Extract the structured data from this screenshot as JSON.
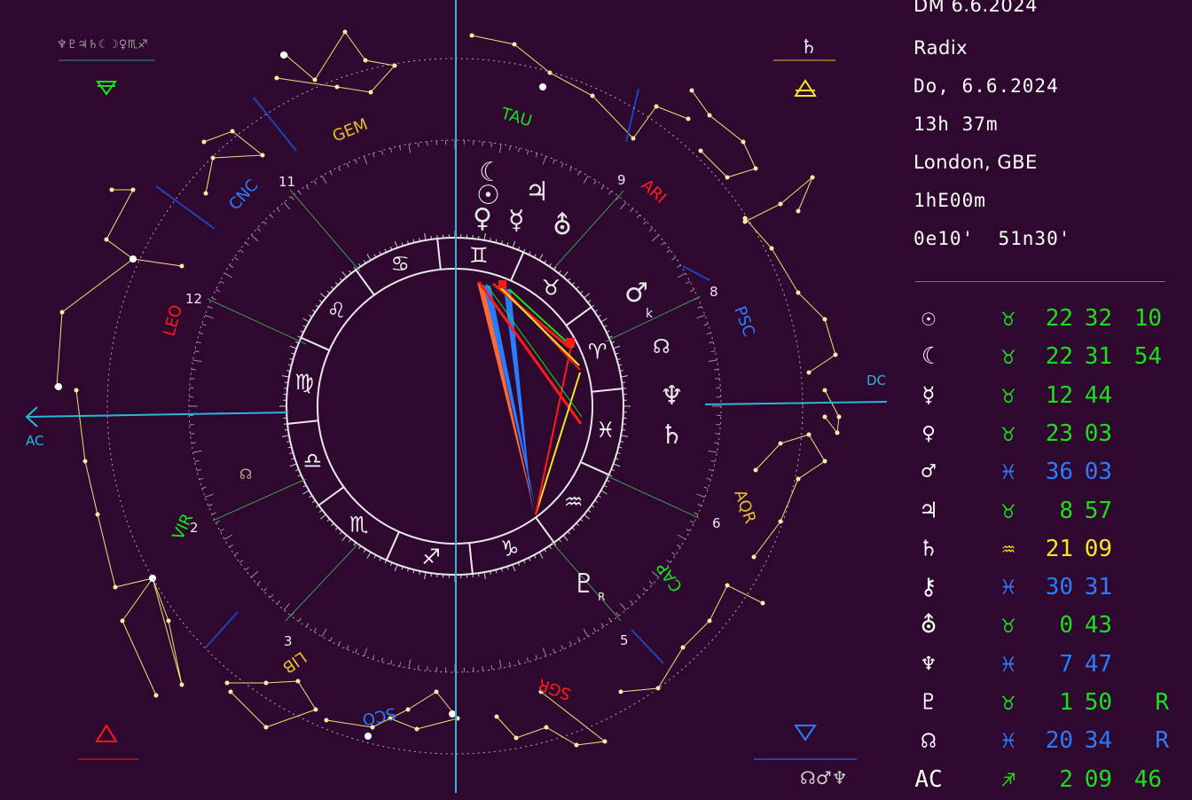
{
  "header": {
    "title": "DM 6.6.2024",
    "chart_type": "Radix",
    "date": "Do, 6.6.2024",
    "time": "13h 37m",
    "place": "London, GBE",
    "zone": "1hE00m",
    "coords": "0e10'  51n30'"
  },
  "colors": {
    "background": "#2f0830",
    "earth": "#19e119",
    "water": "#2a7cff",
    "air": "#f2e623",
    "fire": "#ff1a1a",
    "ring": "#e8e8e8",
    "constellation": "#eee37a",
    "axis": "#2ab7d8"
  },
  "chart": {
    "axis_labels": {
      "ac": "AC",
      "dc": "DC"
    },
    "top_left_glyphs": "♆♇♃♄☾☽♀♏♐",
    "bottom_right_glyphs": "☊♂♆",
    "constellations": [
      "GEM",
      "TAU",
      "ARI",
      "CNC",
      "PSC",
      "LEO",
      "AQR",
      "VIR",
      "CAP",
      "LIB",
      "SCO",
      "SGR"
    ],
    "house_numbers": [
      "11",
      "9",
      "8",
      "12",
      "2",
      "3",
      "5",
      "6"
    ]
  },
  "positions": [
    {
      "planet": "sun-icon",
      "planet_glyph": "☉",
      "sign": "taurus-icon",
      "sign_glyph": "♉",
      "deg": "22",
      "min": "32",
      "sec": "10",
      "retro": "",
      "color": "#19e119"
    },
    {
      "planet": "moon-icon",
      "planet_glyph": "☾",
      "sign": "taurus-icon",
      "sign_glyph": "♉",
      "deg": "22",
      "min": "31",
      "sec": "54",
      "retro": "",
      "color": "#19e119"
    },
    {
      "planet": "mercury-icon",
      "planet_glyph": "☿",
      "sign": "taurus-icon",
      "sign_glyph": "♉",
      "deg": "12",
      "min": "44",
      "sec": "",
      "retro": "",
      "color": "#19e119"
    },
    {
      "planet": "venus-icon",
      "planet_glyph": "♀",
      "sign": "taurus-icon",
      "sign_glyph": "♉",
      "deg": "23",
      "min": "03",
      "sec": "",
      "retro": "",
      "color": "#19e119"
    },
    {
      "planet": "mars-icon",
      "planet_glyph": "♂",
      "sign": "pisces-icon",
      "sign_glyph": "♓",
      "deg": "36",
      "min": "03",
      "sec": "",
      "retro": "",
      "color": "#2a7cff"
    },
    {
      "planet": "jupiter-icon",
      "planet_glyph": "♃",
      "sign": "taurus-icon",
      "sign_glyph": "♉",
      "deg": "8",
      "min": "57",
      "sec": "",
      "retro": "",
      "color": "#19e119"
    },
    {
      "planet": "saturn-icon",
      "planet_glyph": "♄",
      "sign": "aquarius-icon",
      "sign_glyph": "♒",
      "deg": "21",
      "min": "09",
      "sec": "",
      "retro": "",
      "color": "#f2e623"
    },
    {
      "planet": "chiron-icon",
      "planet_glyph": "⚷",
      "sign": "pisces-icon",
      "sign_glyph": "♓",
      "deg": "30",
      "min": "31",
      "sec": "",
      "retro": "",
      "color": "#2a7cff"
    },
    {
      "planet": "uranus-icon",
      "planet_glyph": "⛢",
      "sign": "taurus-icon",
      "sign_glyph": "♉",
      "deg": "0",
      "min": "43",
      "sec": "",
      "retro": "",
      "color": "#19e119"
    },
    {
      "planet": "neptune-icon",
      "planet_glyph": "♆",
      "sign": "pisces-icon",
      "sign_glyph": "♓",
      "deg": "7",
      "min": "47",
      "sec": "",
      "retro": "",
      "color": "#2a7cff"
    },
    {
      "planet": "pluto-icon",
      "planet_glyph": "♇",
      "sign": "taurus-icon",
      "sign_glyph": "♉",
      "deg": "1",
      "min": "50",
      "sec": "",
      "retro": "R",
      "color": "#19e119"
    },
    {
      "planet": "node-icon",
      "planet_glyph": "☊",
      "sign": "pisces-icon",
      "sign_glyph": "♓",
      "deg": "20",
      "min": "34",
      "sec": "",
      "retro": "R",
      "color": "#2a7cff"
    },
    {
      "planet": "ascendant-label",
      "planet_glyph": "AC",
      "sign": "sagittarius-icon",
      "sign_glyph": "♐",
      "deg": "2",
      "min": "09",
      "sec": "46",
      "retro": "",
      "color": "#19e119"
    }
  ]
}
